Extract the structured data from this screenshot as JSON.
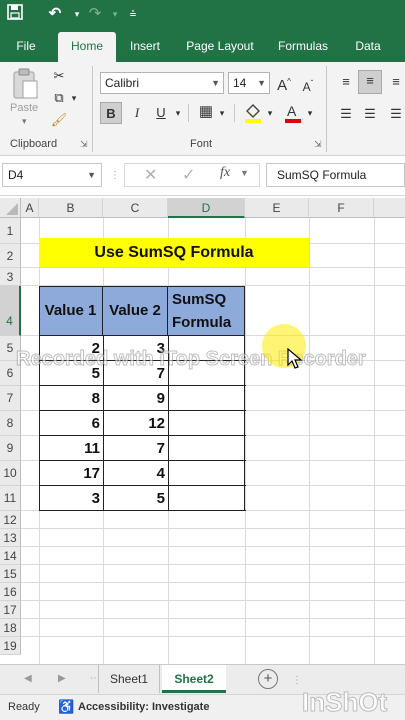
{
  "quick_access": {
    "save_icon": "save-icon",
    "undo_icon": "undo-icon",
    "redo_icon": "redo-icon"
  },
  "ribbon_tabs": [
    {
      "label": "File"
    },
    {
      "label": "Home"
    },
    {
      "label": "Insert"
    },
    {
      "label": "Page Layout"
    },
    {
      "label": "Formulas"
    },
    {
      "label": "Data"
    }
  ],
  "active_tab": "Home",
  "clipboard": {
    "paste_label": "Paste",
    "group_label": "Clipboard"
  },
  "font": {
    "family": "Calibri",
    "size": "14",
    "group_label": "Font",
    "bold": "B",
    "italic": "I",
    "underline": "U"
  },
  "formula_bar": {
    "name_box": "D4",
    "fx": "fx",
    "content": "SumSQ Formula"
  },
  "columns": [
    "A",
    "B",
    "C",
    "D",
    "E",
    "F"
  ],
  "rows": [
    "1",
    "2",
    "3",
    "4",
    "5",
    "6",
    "7",
    "8",
    "9",
    "10",
    "11",
    "12",
    "13",
    "14",
    "15",
    "16",
    "17",
    "18",
    "19"
  ],
  "sheet": {
    "title": "Use SumSQ Formula",
    "headers": [
      "Value 1",
      "Value 2",
      "SumSQ\nFormula"
    ],
    "data": [
      [
        2,
        3
      ],
      [
        5,
        7
      ],
      [
        8,
        9
      ],
      [
        6,
        12
      ],
      [
        11,
        7
      ],
      [
        17,
        4
      ],
      [
        3,
        5
      ]
    ]
  },
  "watermark": "Recorded with iTop Screen Recorder",
  "sheet_tabs": [
    {
      "label": "Sheet1"
    },
    {
      "label": "Sheet2"
    }
  ],
  "active_sheet": "Sheet2",
  "status": {
    "ready": "Ready",
    "accessibility": "Accessibility: Investigate"
  },
  "overlay_logo": "InShOt",
  "colors": {
    "excel_green": "#217346",
    "title_fill": "#ffff00",
    "header_fill": "#8eaadb"
  }
}
